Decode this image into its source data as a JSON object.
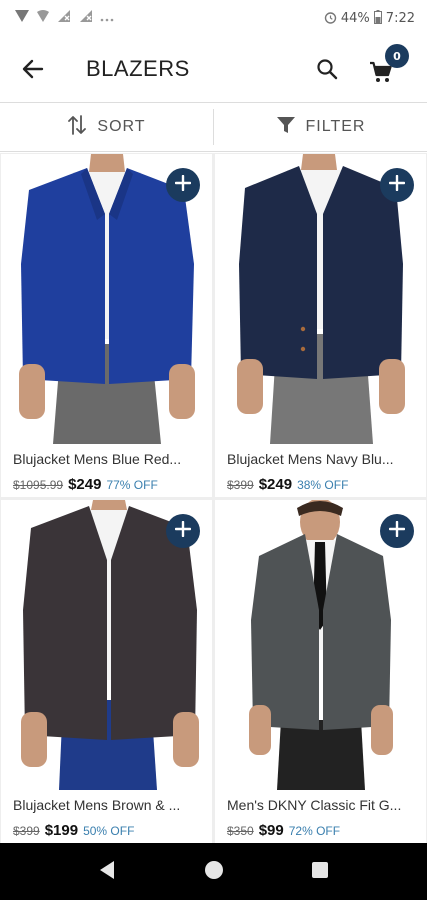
{
  "status_bar": {
    "battery_text": "44%",
    "time": "7:22",
    "notification_icons": [
      "signal-icon",
      "wifi-icon",
      "signal-x-icon",
      "more-icon"
    ]
  },
  "app_bar": {
    "title": "BLAZERS",
    "cart_count": "0"
  },
  "toolbar": {
    "sort_label": "SORT",
    "filter_label": "FILTER"
  },
  "products": [
    {
      "name": "Blujacket Mens Blue Red...",
      "mrp": "$1095.99",
      "price": "$249",
      "discount": "77% OFF",
      "jacket_color": "#1f3f9e"
    },
    {
      "name": "Blujacket Mens Navy Blu...",
      "mrp": "$399",
      "price": "$249",
      "discount": "38% OFF",
      "jacket_color": "#1e2a48"
    },
    {
      "name": "Blujacket Mens Brown & ...",
      "mrp": "$399",
      "price": "$199",
      "discount": "50% OFF",
      "jacket_color": "#3a3438"
    },
    {
      "name": "Men's DKNY Classic Fit G...",
      "mrp": "$350",
      "price": "$99",
      "discount": "72% OFF",
      "jacket_color": "#4f5355"
    }
  ],
  "colors": {
    "accent": "#1b3b5e",
    "discount": "#3a7fae"
  }
}
